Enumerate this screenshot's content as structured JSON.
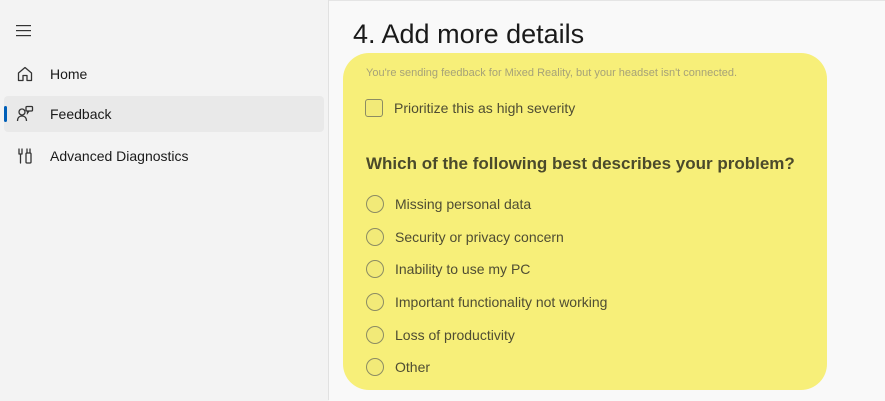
{
  "sidebar": {
    "items": [
      {
        "label": "Home",
        "icon": "home-icon"
      },
      {
        "label": "Feedback",
        "icon": "feedback-icon",
        "selected": true
      },
      {
        "label": "Advanced Diagnostics",
        "icon": "diagnostics-icon"
      }
    ]
  },
  "main": {
    "title": "4. Add more details",
    "notice": "You're sending feedback for Mixed Reality, but your headset isn't connected.",
    "severity_checkbox": {
      "label": "Prioritize this as high severity",
      "checked": false
    },
    "question": "Which of the following best describes your problem?",
    "options": [
      "Missing personal data",
      "Security or privacy concern",
      "Inability to use my PC",
      "Important functionality not working",
      "Loss of productivity",
      "Other"
    ]
  },
  "colors": {
    "accent": "#005fb8",
    "highlight": "#f7ef79"
  }
}
